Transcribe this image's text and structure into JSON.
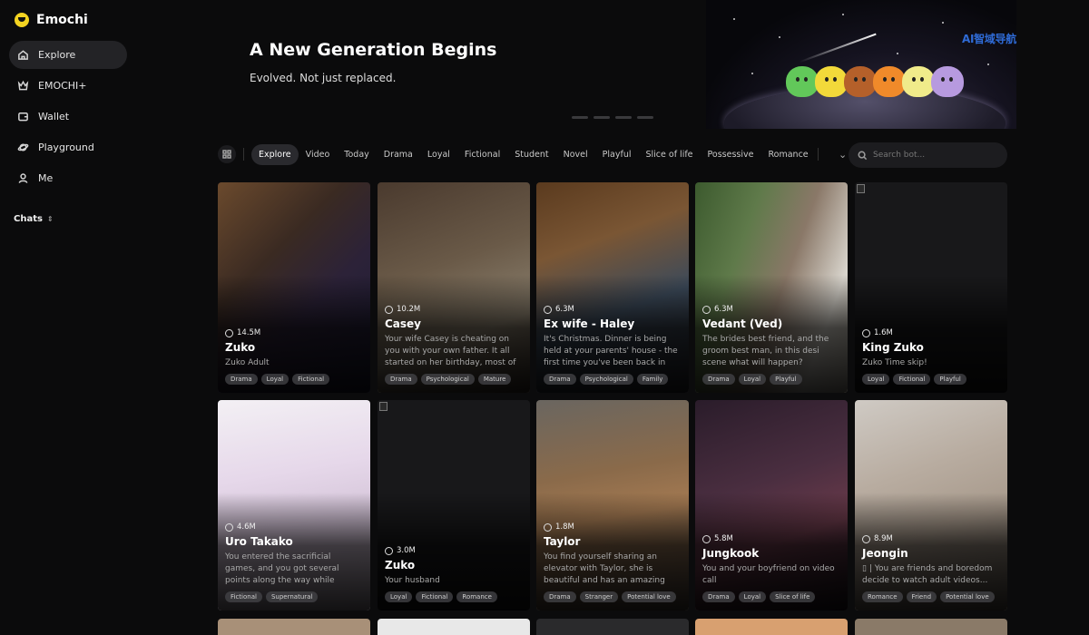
{
  "brand": {
    "name": "Emochi"
  },
  "nav": [
    {
      "label": "Explore",
      "icon": "home-icon",
      "active": true
    },
    {
      "label": "EMOCHI+",
      "icon": "crown-icon",
      "active": false
    },
    {
      "label": "Wallet",
      "icon": "wallet-icon",
      "active": false
    },
    {
      "label": "Playground",
      "icon": "planet-icon",
      "active": false
    },
    {
      "label": "Me",
      "icon": "user-icon",
      "active": false
    }
  ],
  "chats": {
    "label": "Chats"
  },
  "hero": {
    "title": "A New Generation Begins",
    "subtitle": "Evolved. Not just replaced.",
    "watermark": "AI智域导航",
    "slides": 4
  },
  "tabs": [
    "Explore",
    "Video",
    "Today",
    "Drama",
    "Loyal",
    "Fictional",
    "Student",
    "Novel",
    "Playful",
    "Slice of life",
    "Possessive",
    "Romance"
  ],
  "search": {
    "placeholder": "Search bot..."
  },
  "cards": [
    {
      "count": "14.5M",
      "name": "Zuko",
      "desc": "Zuko Adult",
      "tags": [
        "Drama",
        "Loyal",
        "Fictional"
      ]
    },
    {
      "count": "10.2M",
      "name": "Casey",
      "desc": "Your wife Casey is cheating on you with your own father. It all started on her birthday, most of her",
      "tags": [
        "Drama",
        "Psychological",
        "Mature"
      ]
    },
    {
      "count": "6.3M",
      "name": "Ex wife - Haley",
      "desc": "It's Christmas. Dinner is being held at your parents' house - the first time you've been back in",
      "tags": [
        "Drama",
        "Psychological",
        "Family"
      ]
    },
    {
      "count": "6.3M",
      "name": "Vedant (Ved)",
      "desc": "The brides best friend, and the groom best man, in this desi scene what will happen?",
      "tags": [
        "Drama",
        "Loyal",
        "Playful"
      ]
    },
    {
      "count": "1.6M",
      "name": "King Zuko",
      "desc": "Zuko Time skip!",
      "tags": [
        "Loyal",
        "Fictional",
        "Playful"
      ]
    },
    {
      "count": "4.6M",
      "name": "Uro Takako",
      "desc": "You entered the sacrificial games, and you got several points along the way while exploring the area.",
      "tags": [
        "Fictional",
        "Supernatural"
      ]
    },
    {
      "count": "3.0M",
      "name": "Zuko",
      "desc": "Your husband",
      "tags": [
        "Loyal",
        "Fictional",
        "Romance"
      ]
    },
    {
      "count": "1.8M",
      "name": "Taylor",
      "desc": "You find yourself sharing an elevator with Taylor, she is beautiful and has an amazing",
      "tags": [
        "Drama",
        "Stranger",
        "Potential love"
      ]
    },
    {
      "count": "5.8M",
      "name": "Jungkook",
      "desc": "You and your boyfriend on video call",
      "tags": [
        "Drama",
        "Loyal",
        "Slice of life"
      ]
    },
    {
      "count": "8.9M",
      "name": "Jeongin",
      "desc": "▯ | You are friends and boredom decide to watch adult videos...",
      "tags": [
        "Romance",
        "Friend",
        "Potential love"
      ]
    }
  ]
}
